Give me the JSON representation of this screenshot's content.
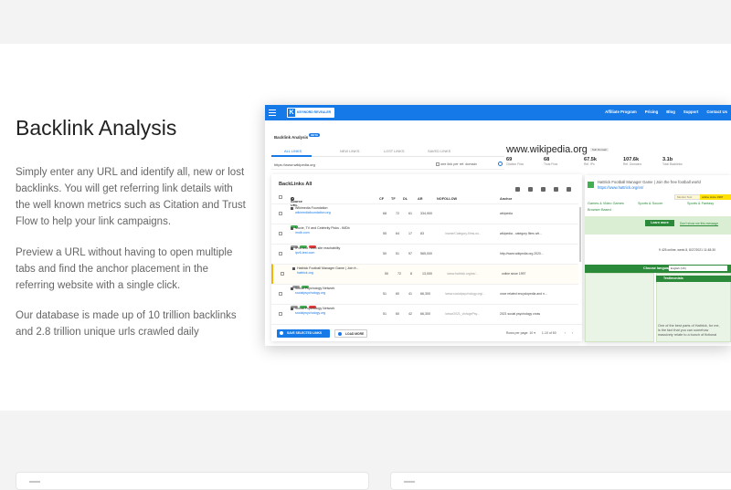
{
  "section": {
    "title": "Backlink Analysis",
    "paragraphs": [
      "Simply enter any URL and identify all, new or lost backlinks. You will get referring link details with the well known metrics such as Citation and Trust Flow to help your link campaigns.",
      "Preview a URL without having to open multiple tabs and find the anchor placement in the referring website with a single click.",
      "Our database is made up of 10 trillion backlinks and 2.8 trillion unique urls crawled daily"
    ]
  },
  "app": {
    "brand": "KEYWORD REVEALER",
    "nav": [
      "Affiliate Program",
      "Pricing",
      "Blog",
      "Support",
      "Contact Us"
    ],
    "page_heading": "Backlink Analysis",
    "version_badge": "BETA",
    "tabs": [
      "ALL LINKS",
      "NEW LINKS",
      "LOST LINKS",
      "SAVED LINKS"
    ],
    "url_value": "https://www.wikipedia.org",
    "one_link_label": "one link per ref. domain",
    "panel_title": "BackLinks All",
    "columns": {
      "source": "Source URL",
      "cf": "CF",
      "tf": "TF",
      "dl": "DL",
      "ar": "AR",
      "nofollow": "NOFOLLOW",
      "anchor": "Anchor"
    },
    "rows": [
      {
        "title": "Wikimedia Foundation",
        "link": "wikimediafoundation.org",
        "cf": "68",
        "tf": "72",
        "dl": "61",
        "ar": "334,900",
        "ref": "",
        "anchor": "wikipedia",
        "tags": [
          "g"
        ]
      },
      {
        "title": "Movie, TV and Celebrity Picks - IMDb",
        "link": "imdb.com",
        "cf": "55",
        "tf": "64",
        "dl": "17",
        "ar": "83",
        "ref": "/name/Category-films-wi...",
        "anchor": "wikipedia - category films wit...",
        "tags": [
          "gy",
          "g",
          "r"
        ]
      },
      {
        "title": "iPv6 test - web site reachability",
        "link": "ipv6-test.com",
        "cf": "50",
        "tf": "51",
        "dl": "57",
        "ar": "565,000",
        "ref": "",
        "anchor": "http://www.wikipedia.org 2020...",
        "tags": [
          "gy",
          "r",
          "r"
        ]
      },
      {
        "title": "Hattrick Football Manager Game | Join fr...",
        "link": "hattrick.org",
        "cf": "50",
        "tf": "72",
        "dl": "8",
        "ar": "13,000",
        "ref": "/www.hattrick.org/es/...",
        "anchor": "online since 1997",
        "tags": [
          "gy",
          "g"
        ]
      },
      {
        "title": "Social Psychology Network",
        "link": "socialpsychology.org",
        "cf": "51",
        "tf": "60",
        "dl": "41",
        "ar": "66,300",
        "ref": "/www.socialpsychology.org/...",
        "anchor": "once related encyclopedia and n...",
        "tags": [
          "gy",
          "g",
          "r"
        ]
      },
      {
        "title": "Social Psychology Network",
        "link": "socialpsychology.org",
        "cf": "51",
        "tf": "60",
        "dl": "42",
        "ar": "66,300",
        "ref": "/www/2021_vintagePsy...",
        "anchor": "2021 social psychology cross",
        "tags": []
      }
    ],
    "save_button": "SAVE SELECTED LINKS",
    "load_button": "LOAD MORE",
    "pager": {
      "rows_label": "Rows per page:",
      "rows_value": "10",
      "range": "1-10 of 50"
    },
    "domain": "www.wikipedia.org",
    "domain_badge": "Sub Domain",
    "metrics": [
      {
        "value": "69",
        "label": "Citation Flow"
      },
      {
        "value": "68",
        "label": "Trust Flow"
      },
      {
        "value": "67.5k",
        "label": "Ref. IPs"
      },
      {
        "value": "107.6k",
        "label": "Ref. Domains"
      },
      {
        "value": "3.1b",
        "label": "Total Backlinks"
      }
    ],
    "preview": {
      "title": "Hattrick Football Manager Game | Join the free football world",
      "url": "https://www.hattrick.org/en/",
      "search_placeholder": "Monitor Text",
      "highlight": "online since 1997",
      "nav": [
        "Games & Video Games",
        "Sports & Soccer",
        "Sports & Fantasy",
        "Browser Based"
      ],
      "learn_more": "Learn more",
      "shortcut": "Don't show me this message",
      "online": "9 425 online, week 8, 8/27/2021 11:48:30",
      "language_label": "Choose language",
      "language_value": "English (UK)",
      "testimonials": "Testimonials",
      "quote": "One of the best parts of Hattrick, for me, is the fact that you can somehow massively relate to a bunch of fictional"
    }
  }
}
